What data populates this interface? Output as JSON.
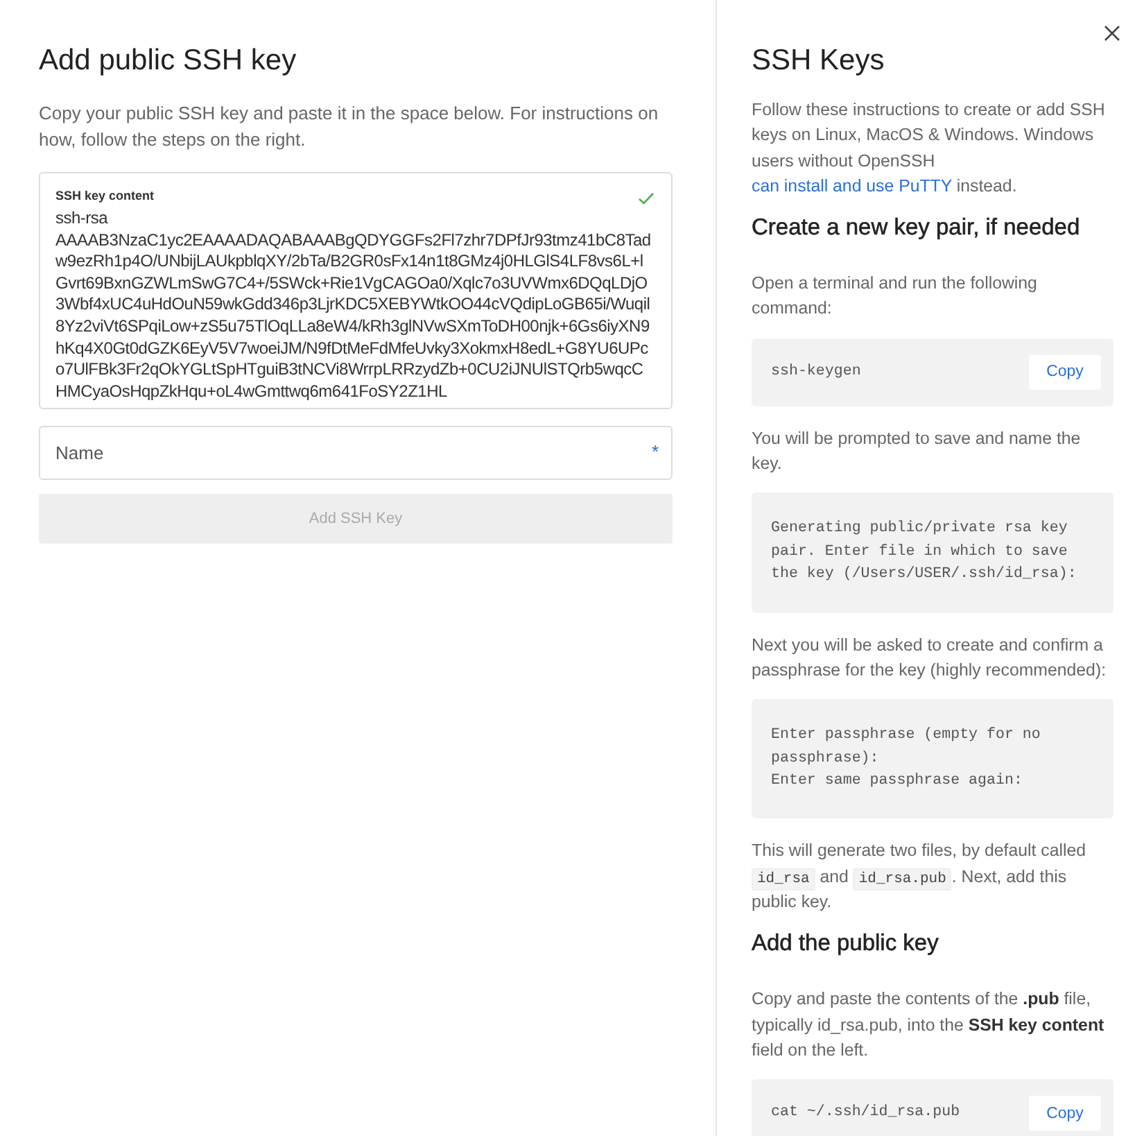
{
  "form": {
    "title": "Add public SSH key",
    "intro": "Copy your public SSH key and paste it in the space below. For instructions on how, follow the steps on the right.",
    "key_field": {
      "label": "SSH key content",
      "value": "ssh-rsa AAAAB3NzaC1yc2EAAAADAQABAAABgQDYGGFs2Fl7zhr7DPfJr93tmz41bC8Tadw9ezRh1p4O/UNbijLAUkpblqXY/2bTa/B2GR0sFx14n1t8GMz4j0HLGlS4LF8vs6L+lGvrt69BxnGZWLmSwG7C4+/5SWck+Rie1VgCAGOa0/Xqlc7o3UVWmx6DQqLDjO3Wbf4xUC4uHdOuN59wkGdd346p3LjrKDC5XEBYWtkOO44cVQdipLoGB65i/Wuqil8Yz2viVt6SPqiLow+zS5u75TlOqLLa8eW4/kRh3glNVwSXmToDH00njk+6Gs6iyXN9hKq4X0Gt0dGZK6EyV5V7woeiJM/N9fDtMeFdMfeUvky3XokmxH8edL+G8YU6UPco7UlFBk3Fr2qOkYGLtSpHTguiB3tNCVi8WrrpLRRzydZb+0CU2iJNUlSTQrb5wqcCHMCyaOsHqpZkHqu+oL4wGmttwq6m641FoSY2Z1HL",
      "valid": true
    },
    "name_field": {
      "placeholder": "Name",
      "required": true,
      "required_mark": "*"
    },
    "submit": {
      "label": "Add SSH Key",
      "disabled": true
    }
  },
  "help": {
    "title": "SSH Keys",
    "blocks": [
      {
        "kind": "paragraph",
        "parts": [
          {
            "kind": "text",
            "text": "Follow these instructions to create or add SSH keys on Linux, MacOS & Windows. Windows users without OpenSSH "
          },
          {
            "kind": "link",
            "text": "can install and use PuTTY"
          },
          {
            "kind": "text",
            "text": " instead."
          }
        ]
      },
      {
        "kind": "heading",
        "text": "Create a new key pair, if needed"
      },
      {
        "kind": "paragraph",
        "parts": [
          {
            "kind": "text",
            "text": "Open a terminal and run the following command:"
          }
        ]
      },
      {
        "kind": "code",
        "text": "ssh-keygen",
        "copy": "Copy"
      },
      {
        "kind": "paragraph",
        "parts": [
          {
            "kind": "text",
            "text": "You will be prompted to save and name the key."
          }
        ]
      },
      {
        "kind": "code",
        "text": "Generating public/private rsa key pair. Enter file in which to save the key (/Users/USER/.ssh/id_rsa):"
      },
      {
        "kind": "paragraph",
        "parts": [
          {
            "kind": "text",
            "text": "Next you will be asked to create and confirm a passphrase for the key (highly recommended):"
          }
        ]
      },
      {
        "kind": "code",
        "text": "Enter passphrase (empty for no passphrase):\nEnter same passphrase again:"
      },
      {
        "kind": "paragraph",
        "parts": [
          {
            "kind": "text",
            "text": "This will generate two files, by default called "
          },
          {
            "kind": "code",
            "text": "id_rsa"
          },
          {
            "kind": "text",
            "text": " and "
          },
          {
            "kind": "code",
            "text": "id_rsa.pub"
          },
          {
            "kind": "text",
            "text": ". Next, add this public key."
          }
        ]
      },
      {
        "kind": "heading",
        "text": "Add the public key"
      },
      {
        "kind": "paragraph",
        "parts": [
          {
            "kind": "text",
            "text": "Copy and paste the contents of the **.pub** file, typically id_rsa.pub, into the **SSH key content** field on the left."
          }
        ]
      },
      {
        "kind": "code",
        "text": "cat ~/.ssh/id_rsa.pub",
        "copy": "Copy"
      }
    ]
  }
}
